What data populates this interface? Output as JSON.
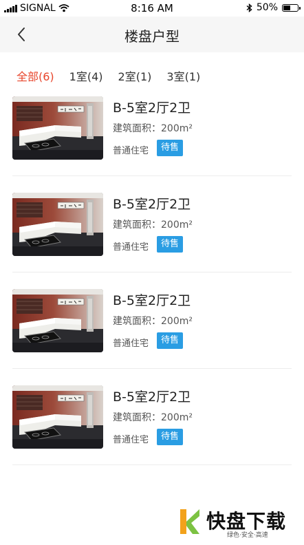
{
  "status_bar": {
    "carrier": "SIGNAL",
    "time": "8:16 AM",
    "battery_text": "50%",
    "battery_level": 0.5
  },
  "nav": {
    "title": "楼盘户型",
    "back_icon": "chevron-left-icon"
  },
  "filter_tabs": [
    {
      "label": "全部(6)",
      "active": true
    },
    {
      "label": "1室(4)",
      "active": false
    },
    {
      "label": "2室(1)",
      "active": false
    },
    {
      "label": "3室(1)",
      "active": false
    }
  ],
  "listings": [
    {
      "title": "B-5室2厅2卫",
      "area": "建筑面积：200m²",
      "type": "普通住宅",
      "status": "待售"
    },
    {
      "title": "B-5室2厅2卫",
      "area": "建筑面积：200m²",
      "type": "普通住宅",
      "status": "待售"
    },
    {
      "title": "B-5室2厅2卫",
      "area": "建筑面积：200m²",
      "type": "普通住宅",
      "status": "待售"
    },
    {
      "title": "B-5室2厅2卫",
      "area": "建筑面积：200m²",
      "type": "普通住宅",
      "status": "待售"
    }
  ],
  "watermark": {
    "main": "快盘下载",
    "sub": "绿色·安全·高速"
  },
  "colors": {
    "accent": "#e8452b",
    "badge": "#2a9de3",
    "nav_bg": "#f6f6f6"
  }
}
